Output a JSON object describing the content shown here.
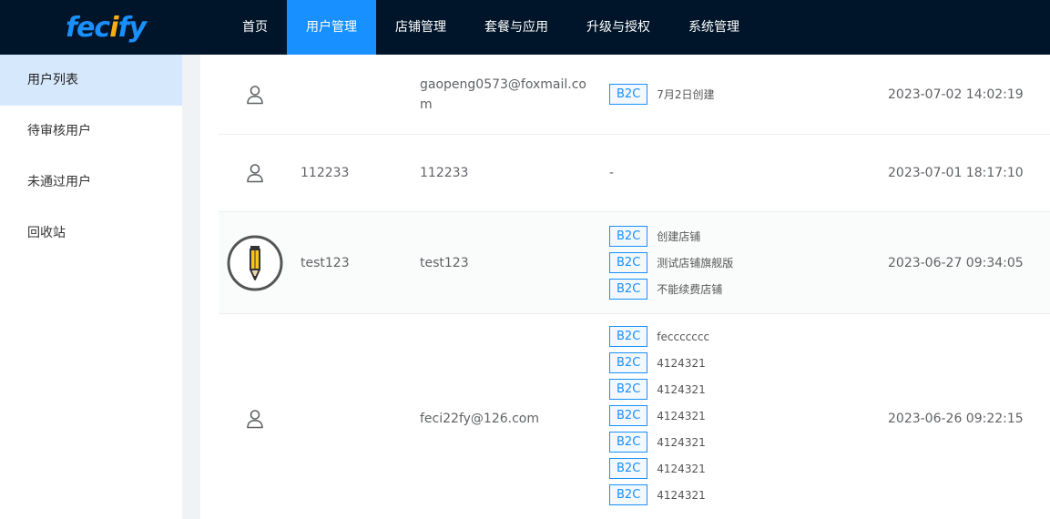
{
  "app": {
    "logo_main": "fec",
    "logo_accent": "i",
    "logo_rest": "fy"
  },
  "nav": {
    "items": [
      {
        "label": "首页"
      },
      {
        "label": "用户管理"
      },
      {
        "label": "店铺管理"
      },
      {
        "label": "套餐与应用"
      },
      {
        "label": "升级与授权"
      },
      {
        "label": "系统管理"
      }
    ],
    "active_index": 1
  },
  "sidebar": {
    "items": [
      {
        "label": "用户列表"
      },
      {
        "label": "待审核用户"
      },
      {
        "label": "未通过用户"
      },
      {
        "label": "回收站"
      }
    ],
    "active_index": 0
  },
  "colors": {
    "accent": "#1890ff",
    "header_bg": "#001529",
    "sidebar_active": "#d6e8fc"
  },
  "users": [
    {
      "avatar": "user-outline-icon",
      "name": "",
      "email": "gaopeng0573@foxmail.com",
      "tags": [
        {
          "type": "B2C",
          "text": "7月2日创建"
        }
      ],
      "created": "2023-07-02 14:02:19"
    },
    {
      "avatar": "user-outline-icon",
      "name": "112233",
      "email": "112233",
      "empty_tags": "-",
      "tags": [],
      "created": "2023-07-01 18:17:10"
    },
    {
      "avatar": "pencil-avatar-icon",
      "name": "test123",
      "email": "test123",
      "tags": [
        {
          "type": "B2C",
          "text": "创建店铺"
        },
        {
          "type": "B2C",
          "text": "测试店铺旗舰版"
        },
        {
          "type": "B2C",
          "text": "不能续费店铺"
        }
      ],
      "created": "2023-06-27 09:34:05"
    },
    {
      "avatar": "user-outline-icon",
      "name": "",
      "email": "feci22fy@126.com",
      "tags": [
        {
          "type": "B2C",
          "text": "feccccccc"
        },
        {
          "type": "B2C",
          "text": "4124321"
        },
        {
          "type": "B2C",
          "text": "4124321"
        },
        {
          "type": "B2C",
          "text": "4124321"
        },
        {
          "type": "B2C",
          "text": "4124321"
        },
        {
          "type": "B2C",
          "text": "4124321"
        },
        {
          "type": "B2C",
          "text": "4124321"
        }
      ],
      "created": "2023-06-26 09:22:15"
    }
  ]
}
